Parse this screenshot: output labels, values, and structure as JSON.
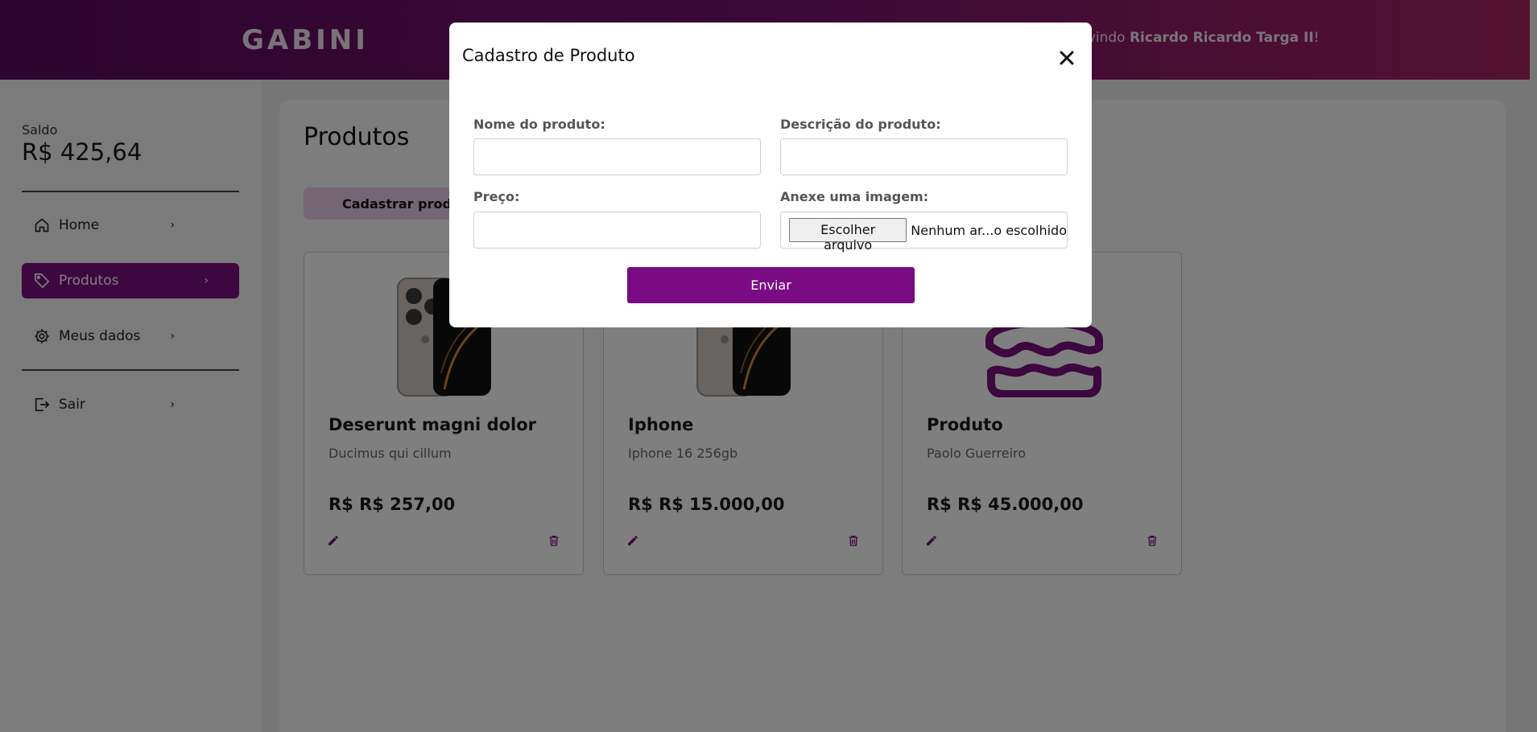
{
  "header": {
    "logo": "GABINI",
    "welcome_prefix": "o vindo ",
    "user_name": "Ricardo Ricardo Targa II",
    "welcome_suffix": "!"
  },
  "sidebar": {
    "saldo_label": "Saldo",
    "saldo_value": "R$ 425,64",
    "items": [
      {
        "label": "Home",
        "icon": "home-icon"
      },
      {
        "label": "Produtos",
        "icon": "tag-icon",
        "active": true
      },
      {
        "label": "Meus dados",
        "icon": "gear-icon"
      },
      {
        "label": "Sair",
        "icon": "logout-icon"
      }
    ]
  },
  "main": {
    "title": "Produtos",
    "cadastrar_label": "Cadastrar produto",
    "products": [
      {
        "name": "Deserunt magni dolor",
        "description": "Ducimus qui cillum",
        "price": "R$ R$ 257,00",
        "image": "iphone-image"
      },
      {
        "name": "Iphone",
        "description": "Iphone 16 256gb",
        "price": "R$ R$ 15.000,00",
        "image": "iphone-image"
      },
      {
        "name": "Produto",
        "description": "Paolo Guerreiro",
        "price": "R$ R$ 45.000,00",
        "image": "cake-icon"
      }
    ]
  },
  "modal": {
    "title": "Cadastro de Produto",
    "fields": {
      "name_label": "Nome do produto:",
      "name_value": "",
      "description_label": "Descrição do produto:",
      "description_value": "",
      "price_label": "Preço:",
      "price_value": "",
      "image_label": "Anexe uma imagem:",
      "file_button": "Escolher arquivo",
      "file_status": "Nenhum ar...o escolhido"
    },
    "submit_label": "Enviar"
  },
  "colors": {
    "accent": "#7b0f7e",
    "header_start": "#5a0a5e",
    "header_end": "#a8245e",
    "cadastrar_bg": "#e9cfe6"
  }
}
